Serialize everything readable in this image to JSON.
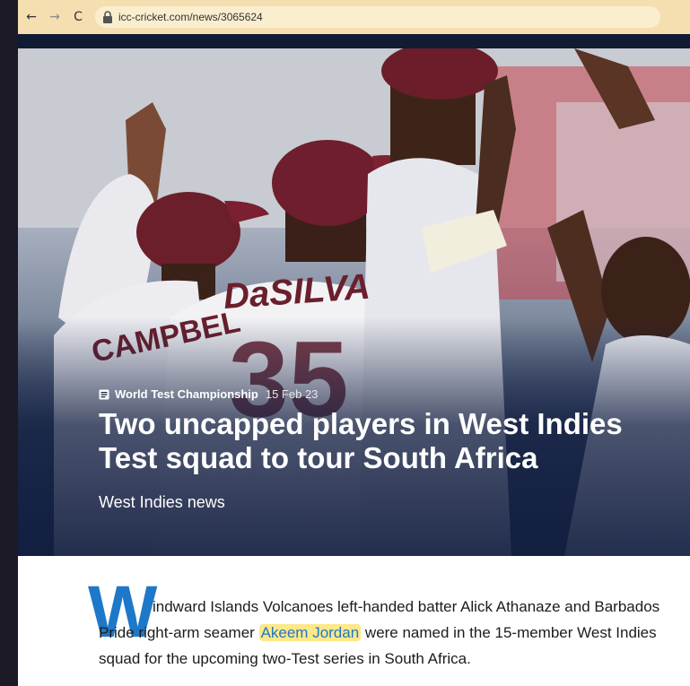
{
  "browser": {
    "url": "icc-cricket.com/news/3065624"
  },
  "article": {
    "category": "World Test Championship",
    "date": "15 Feb 23",
    "headline": "Two uncapped players in West Indies Test squad to tour South Africa",
    "subheadline": "West Indies news",
    "dropcap": "W",
    "body_before": "indward Islands Volcanoes left-handed batter Alick Athanaze and Barbados Pride right-arm seamer ",
    "highlighted_name": "Akeem Jordan",
    "body_after": " were named in the 15-member West Indies squad for the upcoming two-Test series in South Africa."
  },
  "hero": {
    "jersey_names": [
      "CAMPBEL",
      "DaSILVA"
    ],
    "jersey_number": "35"
  }
}
